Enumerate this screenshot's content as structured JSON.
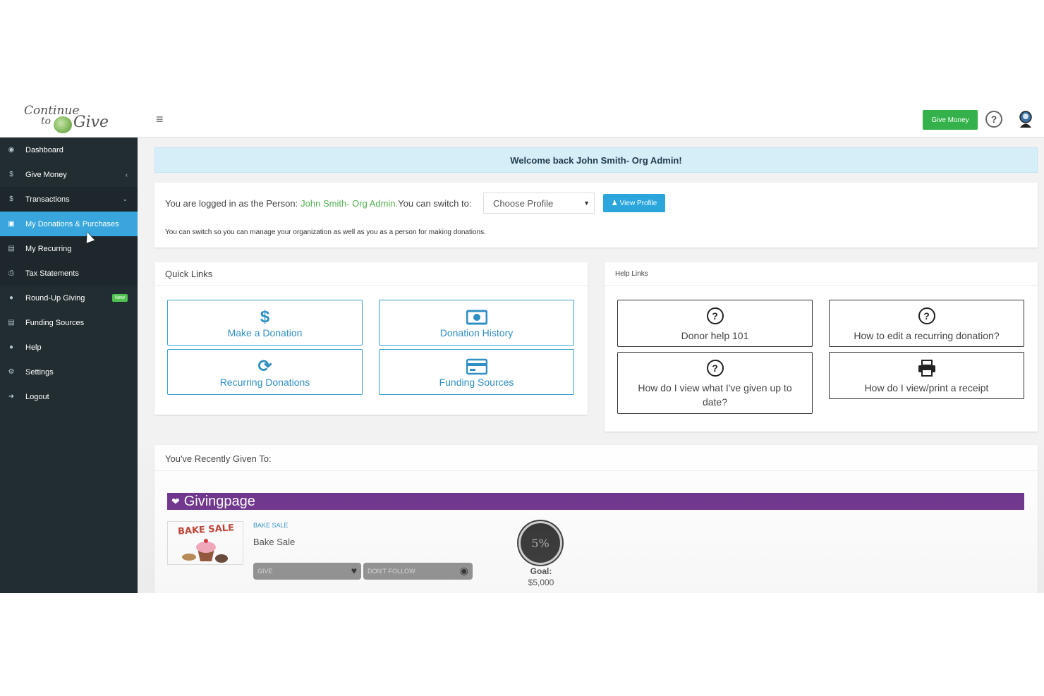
{
  "brand": {
    "logo_line1": "Continue",
    "logo_line2": "to",
    "logo_line3": "Give"
  },
  "sidebar": {
    "items": [
      {
        "label": "Dashboard",
        "icon": "dashboard-icon"
      },
      {
        "label": "Give Money",
        "icon": "dollar-icon"
      },
      {
        "label": "Transactions",
        "icon": "dollar-icon"
      },
      {
        "label": "My Donations & Purchases",
        "icon": "money-icon"
      },
      {
        "label": "My Recurring",
        "icon": "card-icon"
      },
      {
        "label": "Tax Statements",
        "icon": "print-icon"
      },
      {
        "label": "Round-Up Giving",
        "icon": "circle-icon",
        "badge": "New"
      },
      {
        "label": "Funding Sources",
        "icon": "card-icon"
      },
      {
        "label": "Help",
        "icon": "question-icon"
      },
      {
        "label": "Settings",
        "icon": "gear-icon"
      },
      {
        "label": "Logout",
        "icon": "logout-icon"
      }
    ],
    "active_index": 3
  },
  "topbar": {
    "give_money_label": "Give Money",
    "help_symbol": "?"
  },
  "welcome": {
    "text": "Welcome back John Smith- Org Admin!"
  },
  "profile": {
    "prefix": "You are logged in as the Person:",
    "name": "John Smith- Org Admin.",
    "switch_text": "You can switch to:",
    "select_value": "Choose Profile",
    "view_profile_label": "View Profile",
    "note": "You can switch so you can manage your organization as well as you as a person for making donations."
  },
  "quick_links": {
    "title": "Quick Links",
    "items": [
      {
        "label": "Make a Donation",
        "icon": "dollar-icon"
      },
      {
        "label": "Donation History",
        "icon": "money-icon"
      },
      {
        "label": "Recurring Donations",
        "icon": "refresh-icon"
      },
      {
        "label": "Funding Sources",
        "icon": "credit-card-icon"
      }
    ]
  },
  "help_links": {
    "title": "Help Links",
    "items": [
      {
        "label": "Donor help 101",
        "icon": "question-circle-icon"
      },
      {
        "label": "How to edit a recurring donation?",
        "icon": "question-circle-icon"
      },
      {
        "label": "How do I view what I've given up to date?",
        "icon": "question-circle-icon"
      },
      {
        "label": "How do I view/print a receipt",
        "icon": "print-icon"
      }
    ]
  },
  "recent": {
    "title": "You've Recently Given To:",
    "banner": "Givingpage",
    "campaign_image_text": "BAKE SALE",
    "campaign_tag": "BAKE SALE",
    "campaign_name": "Bake Sale",
    "give_label": "GIVE",
    "follow_label": "DON'T FOLLOW",
    "progress": "5%",
    "goal_label": "Goal:",
    "goal_amount": "$5,000"
  },
  "colors": {
    "sidebar_bg": "#222d32",
    "active": "#38a6dc",
    "green": "#34b14a",
    "purple": "#6b2e8a",
    "link_blue": "#2f8fc5"
  }
}
